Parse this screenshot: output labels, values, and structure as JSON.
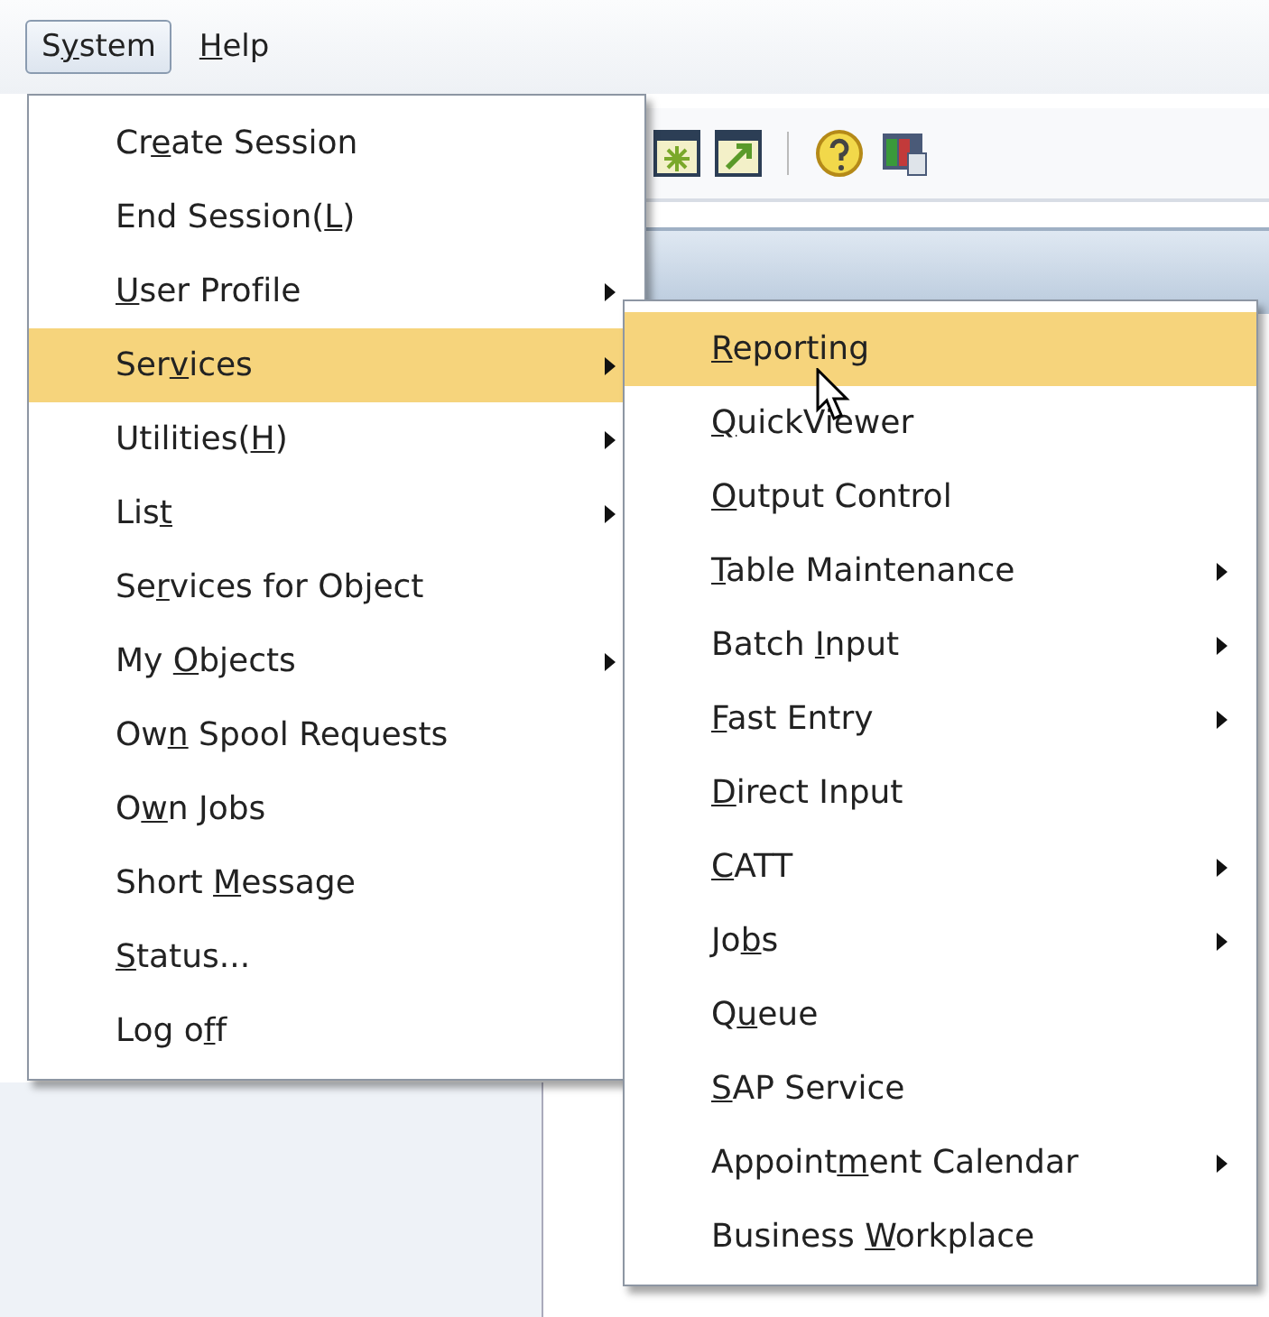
{
  "menu_bar": [
    {
      "before": "S",
      "key": "y",
      "after": "stem",
      "selected": true
    },
    {
      "key": "H",
      "after": "elp",
      "selected": false
    }
  ],
  "system_menu": {
    "items": [
      {
        "before": "Cr",
        "key": "e",
        "after": "ate Session",
        "submenu": false,
        "selected": false
      },
      {
        "before": "End Session(",
        "key": "L",
        "after": ")",
        "submenu": false,
        "selected": false
      },
      {
        "key": "U",
        "after": "ser Profile",
        "submenu": true,
        "selected": false
      },
      {
        "before": "Ser",
        "key": "v",
        "after": "ices",
        "submenu": true,
        "selected": true
      },
      {
        "before": "Utilities(",
        "key": "H",
        "after": ")",
        "submenu": true,
        "selected": false
      },
      {
        "before": "Lis",
        "key": "t",
        "submenu": true,
        "selected": false
      },
      {
        "before": "Se",
        "key": "r",
        "after": "vices for Object",
        "submenu": false,
        "selected": false
      },
      {
        "before": "My ",
        "key": "O",
        "after": "bjects",
        "submenu": true,
        "selected": false
      },
      {
        "before": "Ow",
        "key": "n",
        "after": " Spool Requests",
        "submenu": false,
        "selected": false
      },
      {
        "before": "O",
        "key": "w",
        "after": "n Jobs",
        "submenu": false,
        "selected": false
      },
      {
        "before": "Short ",
        "key": "M",
        "after": "essage",
        "submenu": false,
        "selected": false
      },
      {
        "key": "S",
        "after": "tatus...",
        "submenu": false,
        "selected": false
      },
      {
        "before": "Log o",
        "key": "f",
        "after": "f",
        "submenu": false,
        "selected": false
      }
    ]
  },
  "services_menu": {
    "items": [
      {
        "key": "R",
        "after": "eporting",
        "submenu": false,
        "selected": true
      },
      {
        "key": "Q",
        "after": "uickViewer",
        "submenu": false,
        "selected": false
      },
      {
        "key": "O",
        "after": "utput Control",
        "submenu": false,
        "selected": false
      },
      {
        "key": "T",
        "after": "able Maintenance",
        "submenu": true,
        "selected": false
      },
      {
        "before": "Batch ",
        "key": "I",
        "after": "nput",
        "submenu": true,
        "selected": false
      },
      {
        "key": "F",
        "after": "ast Entry",
        "submenu": true,
        "selected": false
      },
      {
        "key": "D",
        "after": "irect Input",
        "submenu": false,
        "selected": false
      },
      {
        "key": "C",
        "after": "ATT",
        "submenu": true,
        "selected": false
      },
      {
        "before": "Jo",
        "key": "b",
        "after": "s",
        "submenu": true,
        "selected": false
      },
      {
        "before": "Q",
        "key": "u",
        "after": "eue",
        "submenu": false,
        "selected": false
      },
      {
        "key": "S",
        "after": "AP Service",
        "submenu": false,
        "selected": false
      },
      {
        "before": "Appoint",
        "key": "m",
        "after": "ent Calendar",
        "submenu": true,
        "selected": false
      },
      {
        "before": "Business ",
        "key": "W",
        "after": "orkplace",
        "submenu": false,
        "selected": false
      }
    ]
  }
}
